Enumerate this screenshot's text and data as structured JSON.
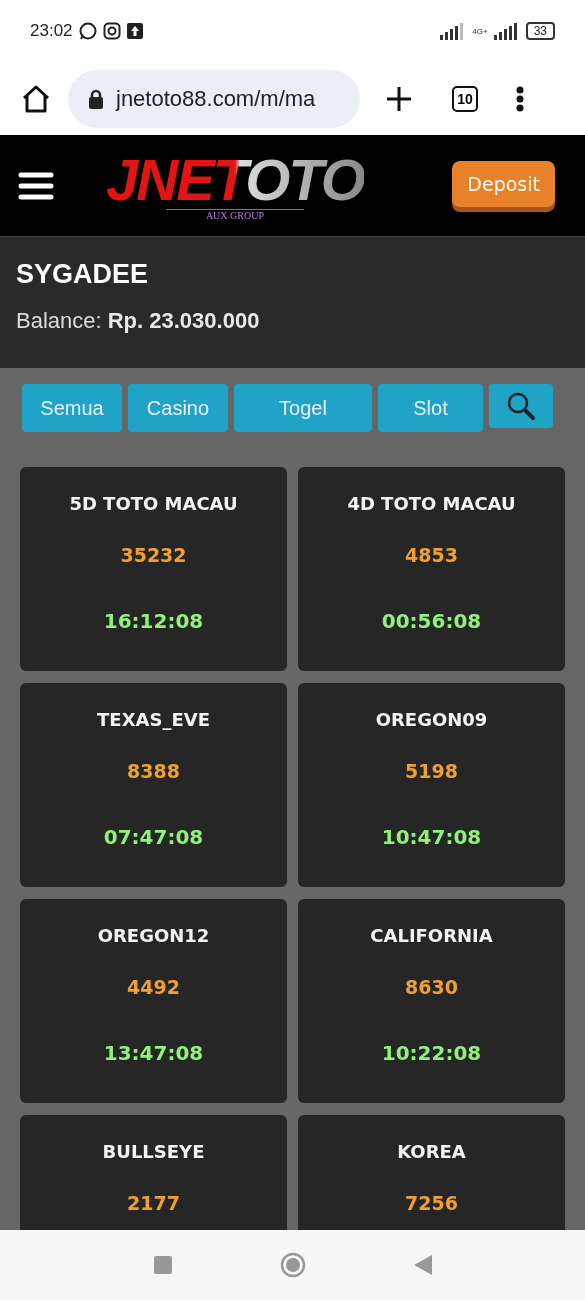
{
  "status_bar": {
    "time": "23:02",
    "network": "4G+",
    "battery": "33"
  },
  "browser": {
    "url": "jnetoto88.com/m/ma",
    "tab_count": "10"
  },
  "header": {
    "logo": {
      "name": "JNETOTO",
      "tagline": "AUX GROUP"
    },
    "deposit_button": "Deposit"
  },
  "account": {
    "username": "SYGADEE",
    "balance_label": "Balance:",
    "balance": "Rp. 23.030.000"
  },
  "filters": [
    "Semua",
    "Casino",
    "Togel",
    "Slot"
  ],
  "markets": [
    {
      "name": "5D TOTO MACAU",
      "number": "35232",
      "time": "16:12:08"
    },
    {
      "name": "4D TOTO MACAU",
      "number": "4853",
      "time": "00:56:08"
    },
    {
      "name": "TEXAS_EVE",
      "number": "8388",
      "time": "07:47:08"
    },
    {
      "name": "OREGON09",
      "number": "5198",
      "time": "10:47:08"
    },
    {
      "name": "OREGON12",
      "number": "4492",
      "time": "13:47:08"
    },
    {
      "name": "CALIFORNIA",
      "number": "8630",
      "time": "10:22:08"
    },
    {
      "name": "BULLSEYE",
      "number": "2177"
    },
    {
      "name": "KOREA",
      "number": "7256"
    }
  ]
}
